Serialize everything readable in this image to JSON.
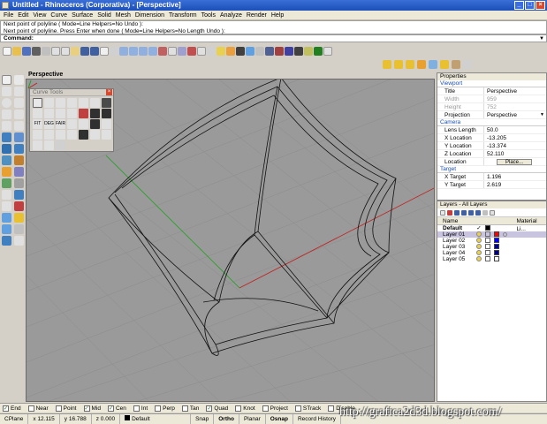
{
  "window": {
    "title": "Untitled - Rhinoceros (Corporativa) - [Perspective]",
    "buttons": [
      "_",
      "□",
      "×"
    ]
  },
  "menu": [
    "File",
    "Edit",
    "View",
    "Curve",
    "Surface",
    "Solid",
    "Mesh",
    "Dimension",
    "Transform",
    "Tools",
    "Analyze",
    "Render",
    "Help"
  ],
  "command": {
    "history": [
      "Next point of polyline ( Mode=Line  Helpers=No  Undo ):",
      "Next point of polyline. Press Enter when done ( Mode=Line  Helpers=No  Length  Undo ):"
    ],
    "prompt": "Command:"
  },
  "viewport": {
    "label": "Perspective"
  },
  "curve_tools": {
    "title": "Curve Tools",
    "close": "×",
    "labels": [
      "FIT",
      "DEG",
      "FAIR"
    ]
  },
  "properties": {
    "header": "Properties",
    "sections": {
      "viewport": "Viewport",
      "camera": "Camera",
      "target": "Target"
    },
    "viewport_rows": [
      {
        "key": "Title",
        "value": "Perspective",
        "disabled": false
      },
      {
        "key": "Width",
        "value": "959",
        "disabled": true
      },
      {
        "key": "Height",
        "value": "752",
        "disabled": true
      },
      {
        "key": "Projection",
        "value": "Perspective",
        "disabled": false
      }
    ],
    "camera_rows": [
      {
        "key": "Lens Length",
        "value": "50.0"
      },
      {
        "key": "X Location",
        "value": "-13.205"
      },
      {
        "key": "Y Location",
        "value": "-13.374"
      },
      {
        "key": "Z Location",
        "value": "52.110"
      },
      {
        "key": "Location",
        "value": "Place..."
      }
    ],
    "target_rows": [
      {
        "key": "X Target",
        "value": "1.196"
      },
      {
        "key": "Y Target",
        "value": "2.619"
      }
    ]
  },
  "layers": {
    "header": "Layers - All Layers",
    "columns": [
      "Name",
      "Material Li..."
    ],
    "rows": [
      {
        "name": "Default",
        "current": true,
        "selected": false,
        "color": "#000000"
      },
      {
        "name": "Layer 01",
        "current": false,
        "selected": true,
        "color": "#ff0000"
      },
      {
        "name": "Layer 02",
        "current": false,
        "selected": false,
        "color": "#0000ff"
      },
      {
        "name": "Layer 03",
        "current": false,
        "selected": false,
        "color": "#0000a0"
      },
      {
        "name": "Layer 04",
        "current": false,
        "selected": false,
        "color": "#000080"
      },
      {
        "name": "Layer 05",
        "current": false,
        "selected": false,
        "color": "#ffffff"
      }
    ]
  },
  "osnap": [
    {
      "label": "End",
      "checked": true
    },
    {
      "label": "Near",
      "checked": false
    },
    {
      "label": "Point",
      "checked": false
    },
    {
      "label": "Mid",
      "checked": true
    },
    {
      "label": "Cen",
      "checked": true
    },
    {
      "label": "Int",
      "checked": false
    },
    {
      "label": "Perp",
      "checked": false
    },
    {
      "label": "Tan",
      "checked": false
    },
    {
      "label": "Quad",
      "checked": true
    },
    {
      "label": "Knot",
      "checked": false
    },
    {
      "label": "Project",
      "checked": false
    },
    {
      "label": "STrack",
      "checked": false
    },
    {
      "label": "Disable",
      "checked": false
    }
  ],
  "status": {
    "cplane": "CPlane",
    "x": "x 12.115",
    "y": "y 16.788",
    "z": "z 0.000",
    "layer": "Default",
    "snap": "Snap",
    "ortho": "Ortho",
    "planar": "Planar",
    "osnap": "Osnap",
    "record_history": "Record History"
  },
  "watermark": "http://grafica2d3d.blogspot.com/",
  "colors": {
    "title_blue": "#1c4fb8",
    "viewport_gray": "#9a9a9a",
    "axis_red": "#c02020",
    "axis_green": "#20a020",
    "wire": "#111111"
  }
}
